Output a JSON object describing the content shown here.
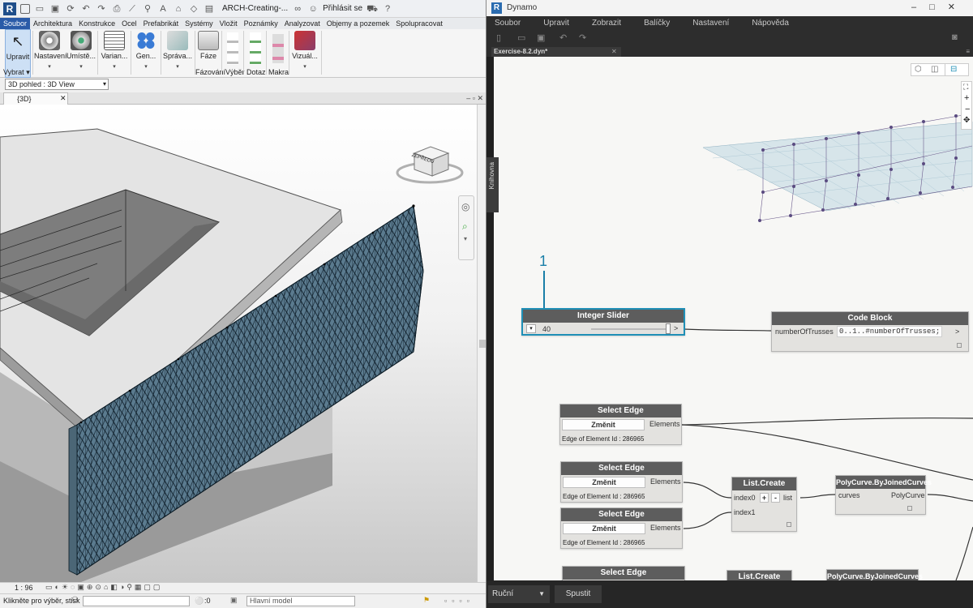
{
  "revit": {
    "qat_title": "ARCH-Creating-...",
    "sign_in": "Přihlásit se",
    "tabs": [
      "Soubor",
      "Architektura",
      "Konstrukce",
      "Ocel",
      "Prefabrikát",
      "Systémy",
      "Vložit",
      "Poznámky",
      "Analyzovat",
      "Objemy a pozemek",
      "Spolupracovat"
    ],
    "ribbon": {
      "upravit": "Upravit",
      "vybrat": "Vybrat",
      "nastaveni": "Nastavení",
      "umiste": "Umístě...",
      "varian": "Varian...",
      "gen": "Gen...",
      "sprava": "Správa...",
      "faze": "Fáze",
      "fazovani": "Fázování",
      "vyber": "Výběr",
      "dotaz": "Dotaz",
      "makra": "Makra",
      "vizual": "Vizuál..."
    },
    "type_selector": "3D pohled : 3D View",
    "view_tab": "{3D}",
    "viewcube_label": "ZEPŘEDU",
    "scale": "1 : 96",
    "status_text": "Klikněte pro výběr, stisk",
    "status_zero": ":0",
    "main_model": "Hlavní model"
  },
  "dynamo": {
    "app_name": "Dynamo",
    "menu": [
      "Soubor",
      "Upravit",
      "Zobrazit",
      "Balíčky",
      "Nastavení",
      "Nápověda"
    ],
    "file_tab": "Exercise-8.2.dyn*",
    "library_label": "Knihovna",
    "run_mode": "Ruční",
    "run_button": "Spustit",
    "callout": "1",
    "nodes": {
      "integer_slider": {
        "title": "Integer Slider",
        "value": "40",
        "max": ">"
      },
      "code_block": {
        "title": "Code Block",
        "input": "numberOfTrusses",
        "code": "0..1..#numberOfTrusses;",
        "output": ">"
      },
      "select_edge_1": {
        "title": "Select Edge",
        "button": "Změnit",
        "output": "Elements",
        "footer": "Edge of Element Id : 286965"
      },
      "select_edge_2": {
        "title": "Select Edge",
        "button": "Změnit",
        "output": "Elements",
        "footer": "Edge of Element Id : 286965"
      },
      "select_edge_3": {
        "title": "Select Edge",
        "button": "Změnit",
        "output": "Elements",
        "footer": "Edge of Element Id : 286965"
      },
      "select_edge_4": {
        "title": "Select Edge"
      },
      "list_create_1": {
        "title": "List.Create",
        "input0": "index0",
        "input1": "index1",
        "plus": "+",
        "minus": "-",
        "output": "list"
      },
      "list_create_2": {
        "title": "List.Create"
      },
      "polycurve_1": {
        "title": "PolyCurve.ByJoinedCurves",
        "input": "curves",
        "output": "PolyCurve"
      },
      "polycurve_2": {
        "title": "PolyCurve.ByJoinedCurves"
      }
    }
  },
  "colors": {
    "revit_tab_active": "#2a5ba8",
    "dynamo_select": "#1f8fb6",
    "node_header": "#5d5d5d",
    "truss": "#1e3c50"
  }
}
